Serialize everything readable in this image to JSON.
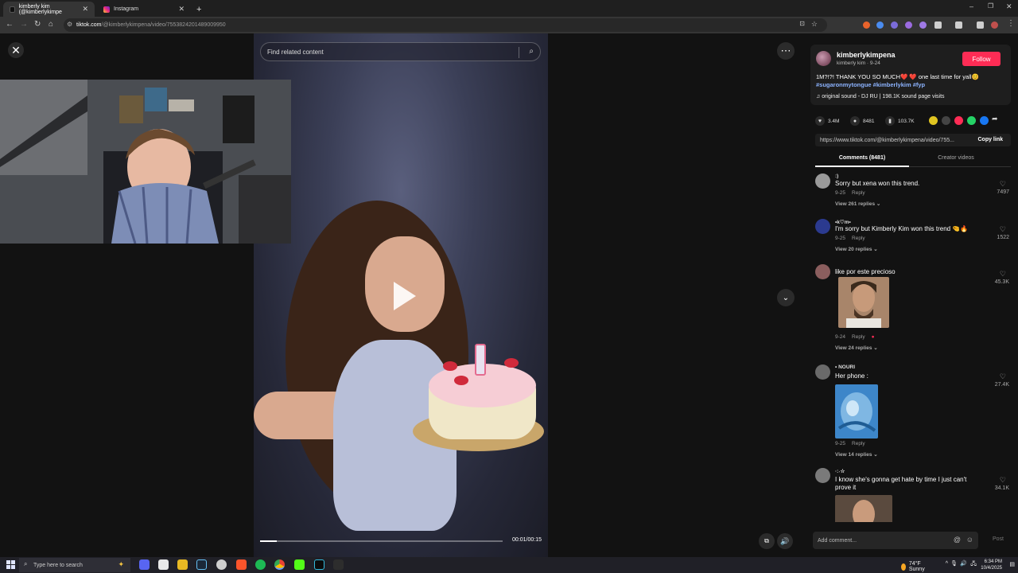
{
  "browser": {
    "tabs": [
      {
        "label": "kimberly kim (@kimberlykimpe",
        "active": true
      },
      {
        "label": "Instagram",
        "active": false
      }
    ],
    "new_tab": "+",
    "url_host": "tiktok.com",
    "url_path": "/@kimberlykimpena/video/7553824201489009950",
    "colors": {
      "tiktok_pink": "#fe2c55",
      "link_blue": "#8cb3ff"
    }
  },
  "video": {
    "search_placeholder": "Find related content",
    "time": "00:01/00:15",
    "progress_fraction": 0.07
  },
  "author": {
    "username": "kimberlykimpena",
    "subline": "kimberly kim · 9-24",
    "follow_label": "Follow",
    "description_text": "1M?!?! THANK YOU SO MUCH❤️ ❤️ one last time for yall😊",
    "hashtags": "#sugaronmytongue #kimberlykim #fyp",
    "sound": "original sound - DJ RU | 198.1K sound page visits"
  },
  "actions": {
    "likes": "3.4M",
    "comments": "8481",
    "saves": "103.7K",
    "link": "https://www.tiktok.com/@kimberlykimpena/video/755...",
    "copy_link": "Copy link"
  },
  "panel_tabs": {
    "comments": "Comments (8481)",
    "creator": "Creator videos"
  },
  "comments": [
    {
      "user": ":)",
      "text": "Sorry but xena won this trend.",
      "date": "9-25",
      "reply": "Reply",
      "replies": "View 261 replies ⌄",
      "likes": "7497"
    },
    {
      "user": "•k♡m•",
      "text": "I'm sorry but Kimberly Kim won this trend 🤏🔥",
      "date": "9-25",
      "reply": "Reply",
      "replies": "View 20 replies ⌄",
      "likes": "1522"
    },
    {
      "user": "",
      "text": "like por este precioso",
      "date": "9-24",
      "reply": "Reply",
      "replies": "View 24 replies ⌄",
      "likes": "45.3K"
    },
    {
      "user": "• NOURI",
      "text": "Her phone :",
      "date": "9-25",
      "reply": "Reply",
      "replies": "View 14 replies ⌄",
      "likes": "27.4K"
    },
    {
      "user": "·:˖☆",
      "text": "I know she's gonna get hate by time I just can't prove it",
      "likes": "34.1K"
    }
  ],
  "comment_input": {
    "placeholder": "Add comment...",
    "post": "Post"
  },
  "taskbar": {
    "search_placeholder": "Type here to search",
    "weather": "74°F  Sunny",
    "time": "6:34 PM",
    "date": "10/4/2025"
  }
}
